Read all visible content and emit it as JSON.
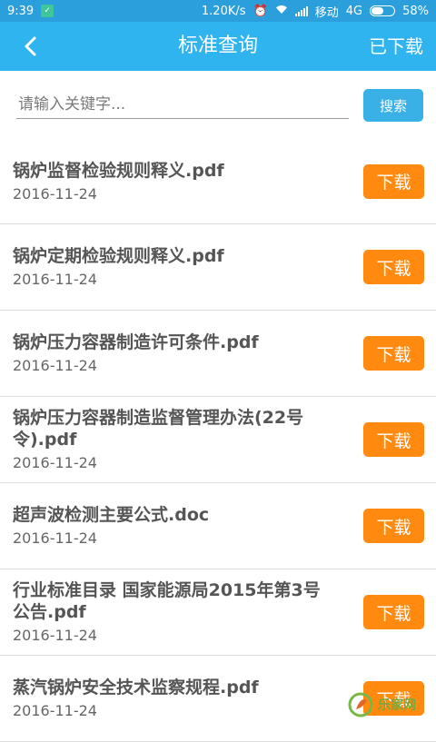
{
  "status_bar": {
    "time": "9:39",
    "speed": "1.20K/s",
    "carrier": "移动",
    "network": "4G",
    "battery": "58%",
    "battery_level": 0.58
  },
  "header": {
    "title": "标准查询",
    "downloaded_label": "已下载"
  },
  "search": {
    "placeholder": "请输入关键字...",
    "value": "",
    "button_label": "搜索"
  },
  "items": [
    {
      "title": "锅炉监督检验规则释义.pdf",
      "date": "2016-11-24",
      "button": "下载"
    },
    {
      "title": "锅炉定期检验规则释义.pdf",
      "date": "2016-11-24",
      "button": "下载"
    },
    {
      "title": "锅炉压力容器制造许可条件.pdf",
      "date": "2016-11-24",
      "button": "下载"
    },
    {
      "title": "锅炉压力容器制造监督管理办法(22号令).pdf",
      "date": "2016-11-24",
      "button": "下载"
    },
    {
      "title": "超声波检测主要公式.doc",
      "date": "2016-11-24",
      "button": "下载"
    },
    {
      "title": "行业标准目录 国家能源局2015年第3号公告.pdf",
      "date": "2016-11-24",
      "button": "下载"
    },
    {
      "title": "蒸汽锅炉安全技术监察规程.pdf",
      "date": "2016-11-24",
      "button": "下载"
    }
  ],
  "watermark": {
    "text": "乐家网"
  },
  "colors": {
    "header": "#2fb4ef",
    "search_button": "#39b1e6",
    "download_button": "#ff8a0f"
  }
}
